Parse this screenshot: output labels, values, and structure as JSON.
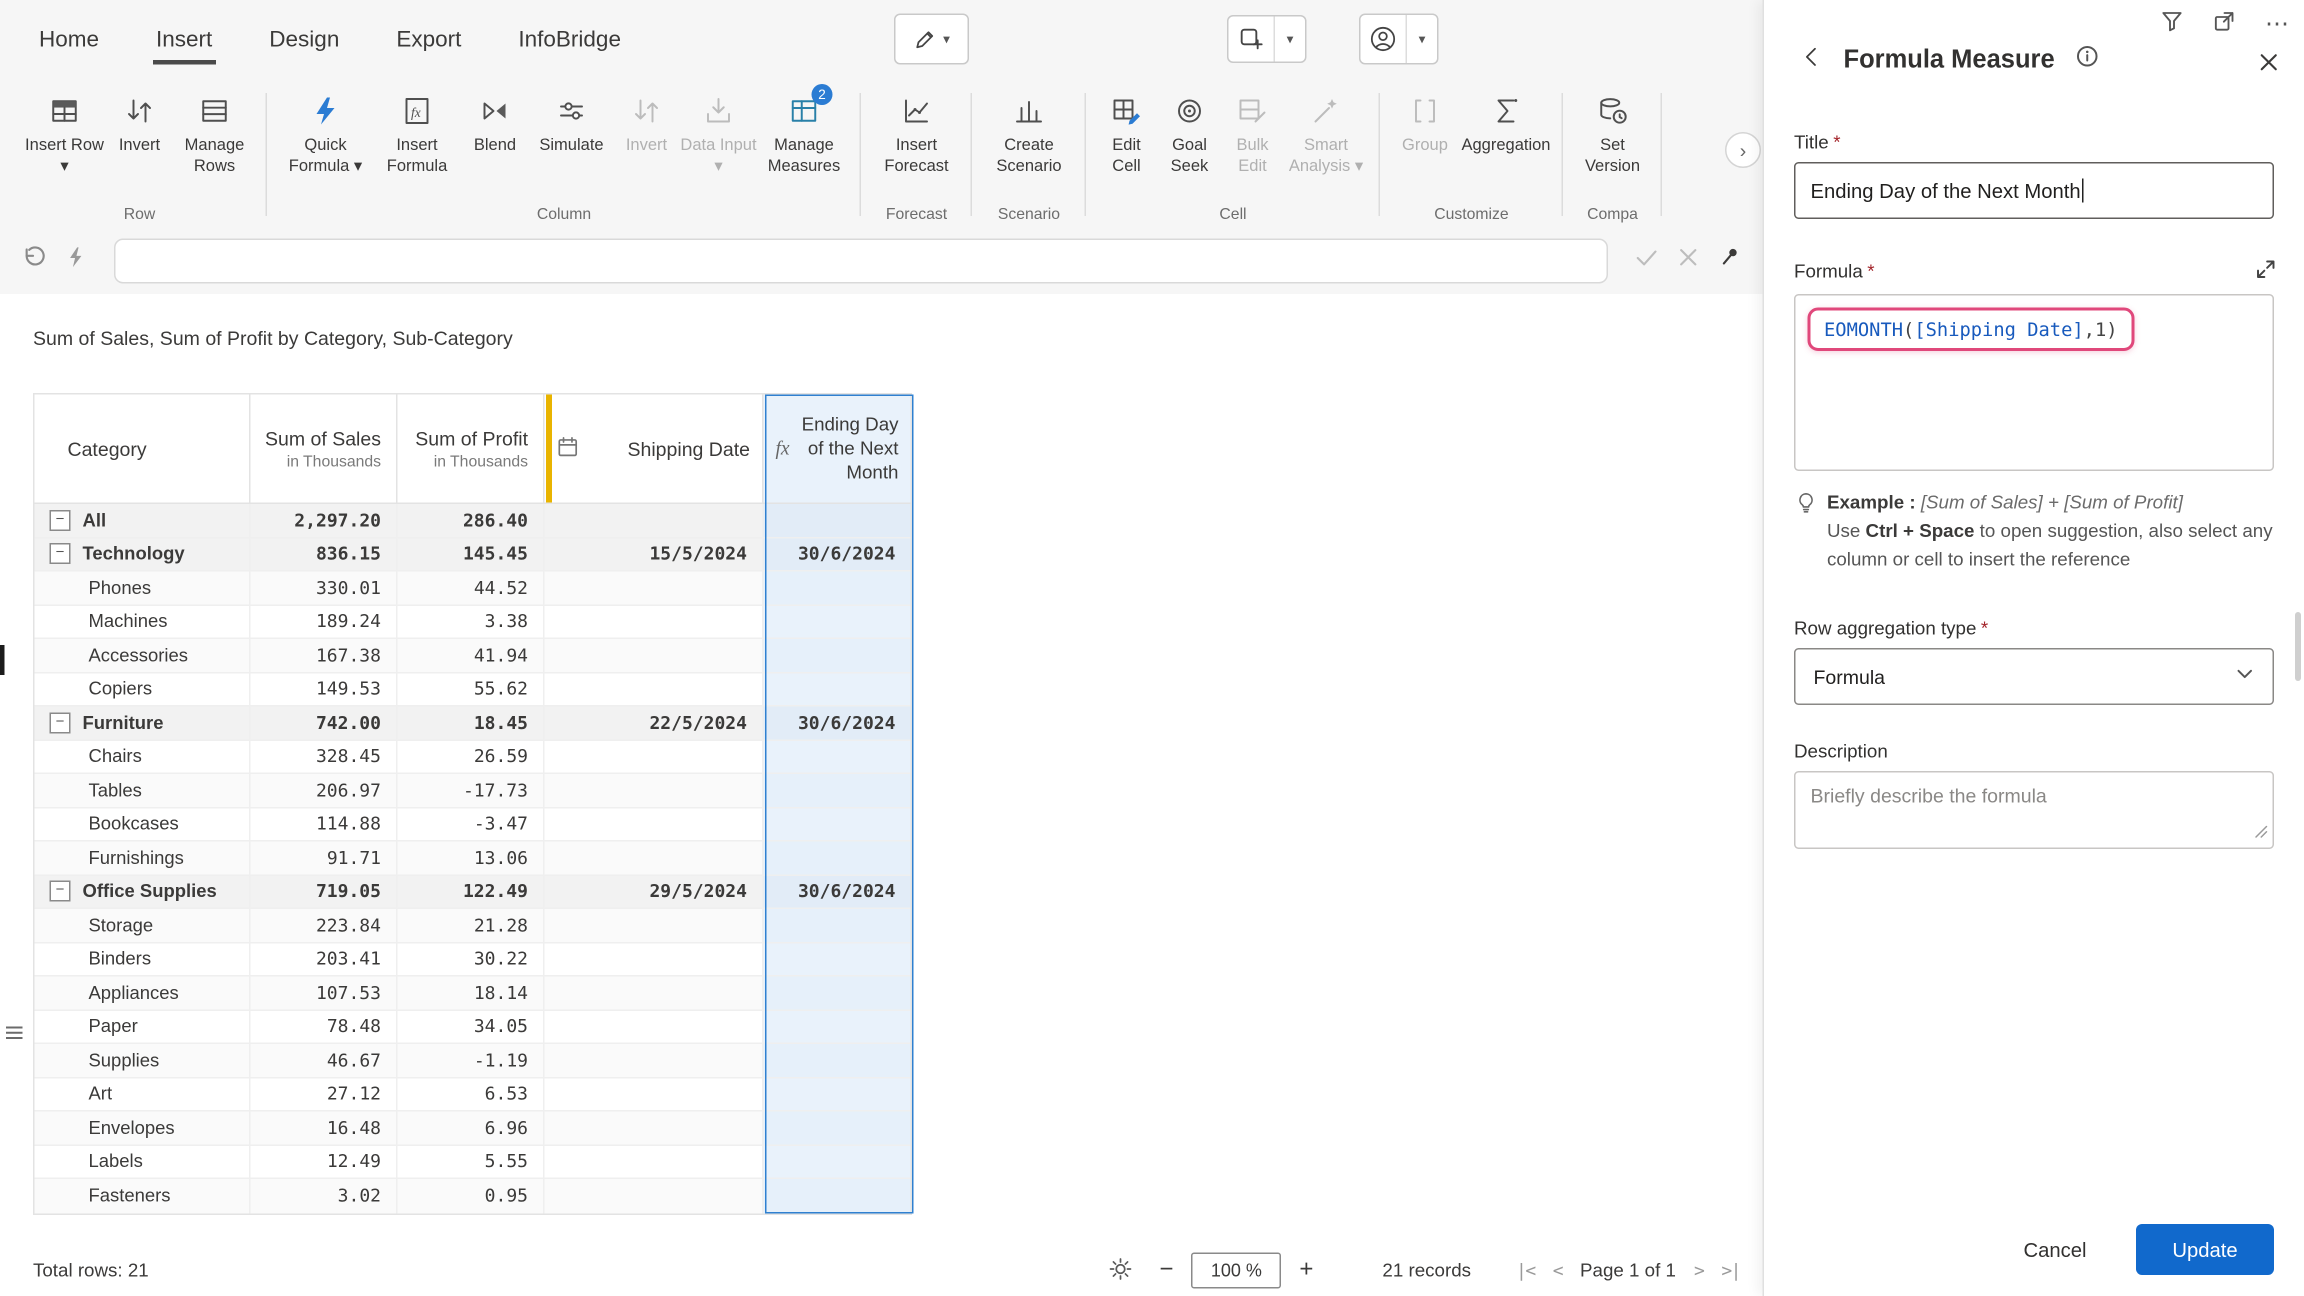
{
  "icons": {
    "fx": "fx"
  },
  "menu": {
    "tabs": [
      {
        "label": "Home"
      },
      {
        "label": "Insert"
      },
      {
        "label": "Design"
      },
      {
        "label": "Export"
      },
      {
        "label": "InfoBridge"
      }
    ],
    "active_tab": "Insert"
  },
  "ribbon": {
    "groups": [
      {
        "label": "Row",
        "items": [
          {
            "label": "Insert Row ▾"
          },
          {
            "label": "Invert"
          },
          {
            "label": "Manage Rows"
          }
        ]
      },
      {
        "label": "Column",
        "items": [
          {
            "label": "Quick Formula ▾"
          },
          {
            "label": "Insert Formula"
          },
          {
            "label": "Blend"
          },
          {
            "label": "Simulate"
          },
          {
            "label": "Invert",
            "disabled": true
          },
          {
            "label": "Data Input ▾",
            "disabled": true
          },
          {
            "label": "Manage Measures",
            "badge": "2"
          }
        ]
      },
      {
        "label": "Forecast",
        "items": [
          {
            "label": "Insert Forecast"
          }
        ]
      },
      {
        "label": "Scenario",
        "items": [
          {
            "label": "Create Scenario"
          }
        ]
      },
      {
        "label": "Cell",
        "items": [
          {
            "label": "Edit Cell"
          },
          {
            "label": "Goal Seek"
          },
          {
            "label": "Bulk Edit",
            "disabled": true
          },
          {
            "label": "Smart Analysis ▾",
            "disabled": true
          }
        ]
      },
      {
        "label": "Customize",
        "items": [
          {
            "label": "Group",
            "disabled": true
          },
          {
            "label": "Aggregation"
          }
        ]
      },
      {
        "label": "Compa",
        "items": [
          {
            "label": "Set Version"
          }
        ]
      }
    ]
  },
  "formula_bar": {
    "value": ""
  },
  "main": {
    "title": "Sum of Sales, Sum of Profit by Category, Sub-Category"
  },
  "table": {
    "columns": [
      {
        "title": "Category"
      },
      {
        "title": "Sum of Sales",
        "sub": "in Thousands"
      },
      {
        "title": "Sum of Profit",
        "sub": "in Thousands"
      },
      {
        "title": "Shipping Date"
      },
      {
        "title": "Ending Day of the Next Month"
      }
    ],
    "rows": [
      {
        "type": "group",
        "name": "All",
        "sales": "2,297.20",
        "profit": "286.40",
        "shipping": "",
        "ending": ""
      },
      {
        "type": "group",
        "name": "Technology",
        "sales": "836.15",
        "profit": "145.45",
        "shipping": "15/5/2024",
        "ending": "30/6/2024"
      },
      {
        "type": "sub",
        "name": "Phones",
        "sales": "330.01",
        "profit": "44.52"
      },
      {
        "type": "sub",
        "name": "Machines",
        "sales": "189.24",
        "profit": "3.38"
      },
      {
        "type": "sub",
        "name": "Accessories",
        "sales": "167.38",
        "profit": "41.94"
      },
      {
        "type": "sub",
        "name": "Copiers",
        "sales": "149.53",
        "profit": "55.62"
      },
      {
        "type": "group",
        "name": "Furniture",
        "sales": "742.00",
        "profit": "18.45",
        "shipping": "22/5/2024",
        "ending": "30/6/2024"
      },
      {
        "type": "sub",
        "name": "Chairs",
        "sales": "328.45",
        "profit": "26.59"
      },
      {
        "type": "sub",
        "name": "Tables",
        "sales": "206.97",
        "profit": "-17.73"
      },
      {
        "type": "sub",
        "name": "Bookcases",
        "sales": "114.88",
        "profit": "-3.47"
      },
      {
        "type": "sub",
        "name": "Furnishings",
        "sales": "91.71",
        "profit": "13.06"
      },
      {
        "type": "group",
        "name": "Office Supplies",
        "sales": "719.05",
        "profit": "122.49",
        "shipping": "29/5/2024",
        "ending": "30/6/2024"
      },
      {
        "type": "sub",
        "name": "Storage",
        "sales": "223.84",
        "profit": "21.28"
      },
      {
        "type": "sub",
        "name": "Binders",
        "sales": "203.41",
        "profit": "30.22"
      },
      {
        "type": "sub",
        "name": "Appliances",
        "sales": "107.53",
        "profit": "18.14"
      },
      {
        "type": "sub",
        "name": "Paper",
        "sales": "78.48",
        "profit": "34.05"
      },
      {
        "type": "sub",
        "name": "Supplies",
        "sales": "46.67",
        "profit": "-1.19"
      },
      {
        "type": "sub",
        "name": "Art",
        "sales": "27.12",
        "profit": "6.53"
      },
      {
        "type": "sub",
        "name": "Envelopes",
        "sales": "16.48",
        "profit": "6.96"
      },
      {
        "type": "sub",
        "name": "Labels",
        "sales": "12.49",
        "profit": "5.55"
      },
      {
        "type": "sub",
        "name": "Fasteners",
        "sales": "3.02",
        "profit": "0.95"
      }
    ]
  },
  "statusbar": {
    "total_rows": "Total rows: 21",
    "zoom": "100 %",
    "records": "21 records",
    "page": "Page 1 of 1"
  },
  "panel": {
    "title": "Formula Measure",
    "title_field": {
      "label": "Title",
      "required": "*",
      "value": "Ending Day of the Next Month"
    },
    "formula_field": {
      "label": "Formula",
      "required": "*",
      "fn": "EOMONTH",
      "open": "(",
      "ref": "[Shipping Date]",
      "close": ",1)"
    },
    "example": {
      "label": "Example :",
      "formula": "[Sum of Sales] + [Sum of Profit]",
      "hint_pre": "Use ",
      "hint_bold": "Ctrl + Space",
      "hint_post": " to open suggestion, also select any column or cell to insert the reference"
    },
    "aggregation": {
      "label": "Row aggregation type",
      "required": "*",
      "value": "Formula"
    },
    "description": {
      "label": "Description",
      "placeholder": "Briefly describe the formula"
    },
    "cancel": "Cancel",
    "update": "Update"
  }
}
